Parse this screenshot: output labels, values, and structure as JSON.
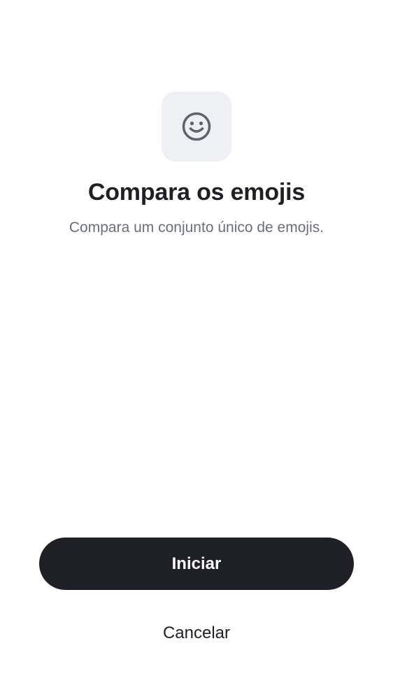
{
  "icon": {
    "name": "smiley-face-icon",
    "color": "#5f636b",
    "background": "#eff0f3"
  },
  "header": {
    "title": "Compara os emojis",
    "subtitle": "Compara um conjunto único de emojis."
  },
  "actions": {
    "primary_label": "Iniciar",
    "secondary_label": "Cancelar"
  },
  "colors": {
    "primary_button": "#1f2025",
    "title_text": "#1f2024",
    "subtitle_text": "#6b6f78"
  }
}
